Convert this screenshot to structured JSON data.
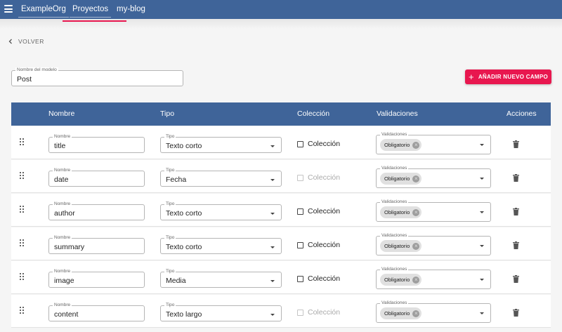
{
  "header": {
    "tabs": [
      {
        "label": "ExampleOrg"
      },
      {
        "label": "Proyectos"
      },
      {
        "label": "my-blog"
      }
    ]
  },
  "back_label": "VOLVER",
  "model": {
    "legend": "Nombre del modelo",
    "value": "Post"
  },
  "add_button": {
    "label": "AÑADIR NUEVO CAMPO"
  },
  "table": {
    "headers": {
      "name": "Nombre",
      "type": "Tipo",
      "collection": "Colección",
      "validations": "Validaciones",
      "actions": "Acciones"
    },
    "field_labels": {
      "name": "Nombre",
      "type": "Tipo",
      "validations": "Validaciones",
      "collection": "Colección"
    },
    "rows": [
      {
        "name": "title",
        "type": "Texto corto",
        "collection_enabled": true,
        "validation": "Obligatorio"
      },
      {
        "name": "date",
        "type": "Fecha",
        "collection_enabled": false,
        "validation": "Obligatorio"
      },
      {
        "name": "author",
        "type": "Texto corto",
        "collection_enabled": true,
        "validation": "Obligatorio"
      },
      {
        "name": "summary",
        "type": "Texto corto",
        "collection_enabled": true,
        "validation": "Obligatorio"
      },
      {
        "name": "image",
        "type": "Media",
        "collection_enabled": true,
        "validation": "Obligatorio"
      },
      {
        "name": "content",
        "type": "Texto largo",
        "collection_enabled": false,
        "validation": "Obligatorio"
      }
    ]
  },
  "colors": {
    "primary": "#3f6499",
    "accent": "#e8174f"
  }
}
